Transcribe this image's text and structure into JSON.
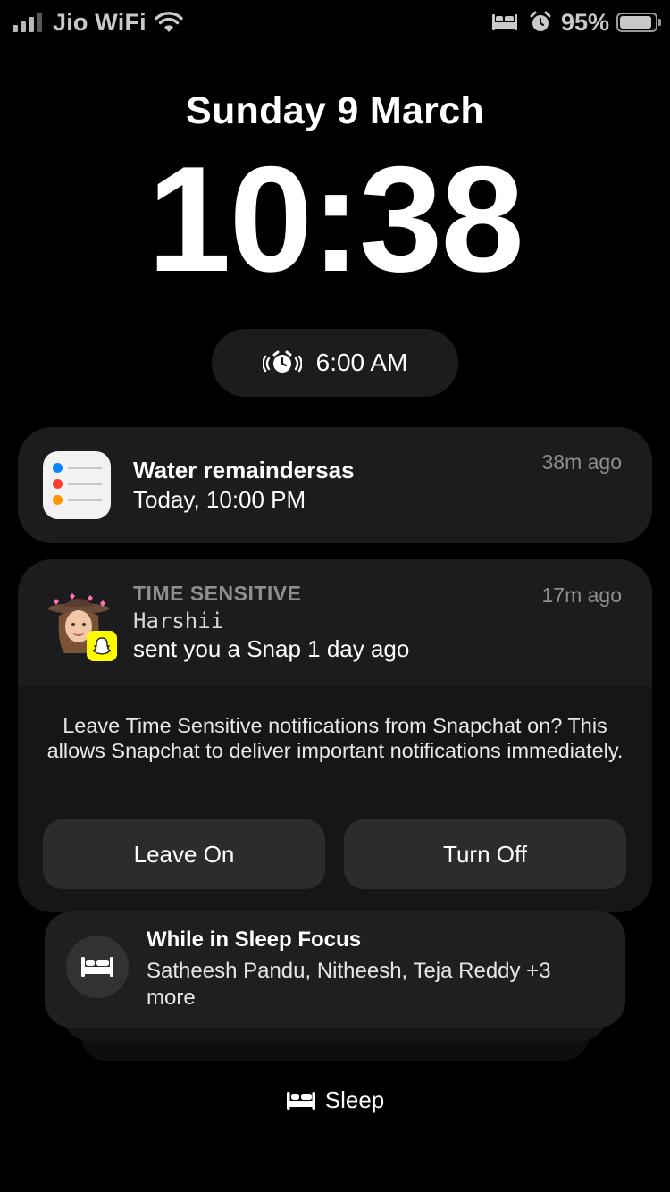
{
  "status_bar": {
    "carrier": "Jio WiFi",
    "battery_percent": "95%",
    "battery_level": 0.95,
    "icons": [
      "signal-icon",
      "wifi-icon",
      "bed-icon",
      "alarm-icon",
      "battery-icon"
    ]
  },
  "lockscreen": {
    "date": "Sunday 9 March",
    "time": "10:38",
    "alarm_time": "6:00 AM"
  },
  "notifications": {
    "reminder": {
      "app_icon": "reminders-icon",
      "title": "Water remaindersas",
      "body": "Today, 10:00 PM",
      "time": "38m ago"
    },
    "snapchat": {
      "app_icon": "snapchat-icon",
      "label": "TIME SENSITIVE",
      "sender": "Harshii",
      "body": "sent you a Snap 1 day ago",
      "time": "17m ago",
      "prompt": "Leave Time Sensitive notifications from Snapchat on? This allows Snapchat to deliver important notifications immediately.",
      "leave_on_label": "Leave On",
      "turn_off_label": "Turn Off"
    },
    "sleep_focus": {
      "icon": "bed-icon",
      "title": "While in Sleep Focus",
      "body": "Satheesh Pandu, Nitheesh, Teja Reddy +3 more"
    }
  },
  "focus": {
    "icon": "bed-icon",
    "label": "Sleep"
  },
  "colors": {
    "background": "#000000",
    "card": "#1c1c1e",
    "button": "#2c2c2e",
    "secondary_text": "#8e8e93",
    "snap_yellow": "#fffc00"
  }
}
